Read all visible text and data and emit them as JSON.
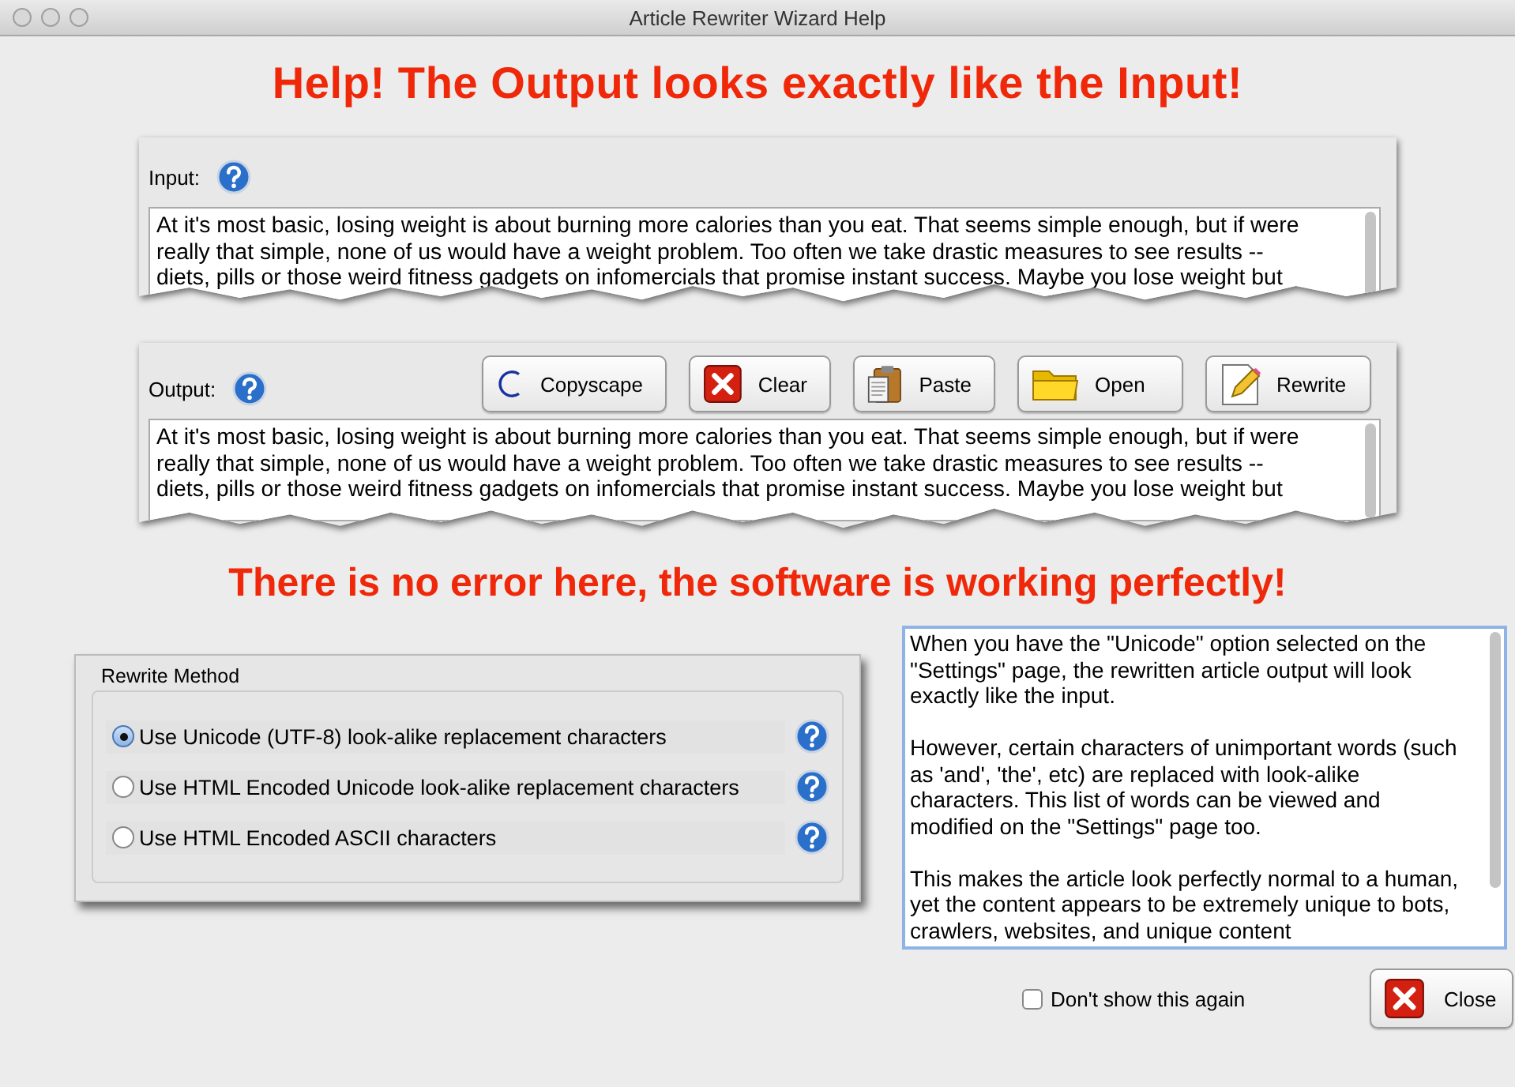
{
  "window": {
    "title": "Article Rewriter Wizard Help"
  },
  "headline": "Help!  The Output looks exactly like the Input!",
  "input": {
    "label": "Input:",
    "lines": [
      "At it's most basic, losing weight is about burning more calories than you eat. That seems simple enough, but if were",
      "really that simple, none of us would have a weight problem. Too often we take drastic measures to see results --",
      "diets, pills or those weird fitness gadgets on infomercials that promise instant success. Maybe you lose weight but"
    ]
  },
  "output": {
    "label": "Output:",
    "buttons": [
      {
        "kind": "copyscape",
        "label": "Copyscape"
      },
      {
        "kind": "clear",
        "label": "Clear"
      },
      {
        "kind": "paste",
        "label": "Paste"
      },
      {
        "kind": "open",
        "label": "Open"
      },
      {
        "kind": "rewrite",
        "label": "Rewrite"
      }
    ],
    "lines": [
      "At it's most basic, losing weight is about burning more calories than you eat. That seems simple enough, but if were",
      "really that simple, none of us would have a weight problem. Too often we take drastic measures to see results --",
      "diets, pills or those weird fitness gadgets on infomercials that promise instant success. Maybe you lose weight but"
    ]
  },
  "subheadline": "There is no error here, the software is working perfectly!",
  "rewrite_method": {
    "title": "Rewrite Method",
    "options": [
      {
        "label": "Use Unicode (UTF-8) look-alike replacement characters",
        "selected": true
      },
      {
        "label": "Use HTML Encoded Unicode look-alike replacement characters",
        "selected": false
      },
      {
        "label": "Use HTML Encoded ASCII characters",
        "selected": false
      }
    ]
  },
  "explanation": [
    "When you have the \"Unicode\" option selected on the \"Settings\" page, the rewritten article output will look exactly like the input.",
    "However, certain characters of unimportant words (such as 'and', 'the', etc) are replaced with look-alike characters.  This list of words can be viewed and modified on the \"Settings\" page too.",
    "This makes the article look perfectly normal to a human, yet the content appears to be extremely unique to bots, crawlers, websites, and unique content"
  ],
  "dont_show_again": {
    "label": "Don't show this again",
    "checked": false
  },
  "close_button": "Close"
}
